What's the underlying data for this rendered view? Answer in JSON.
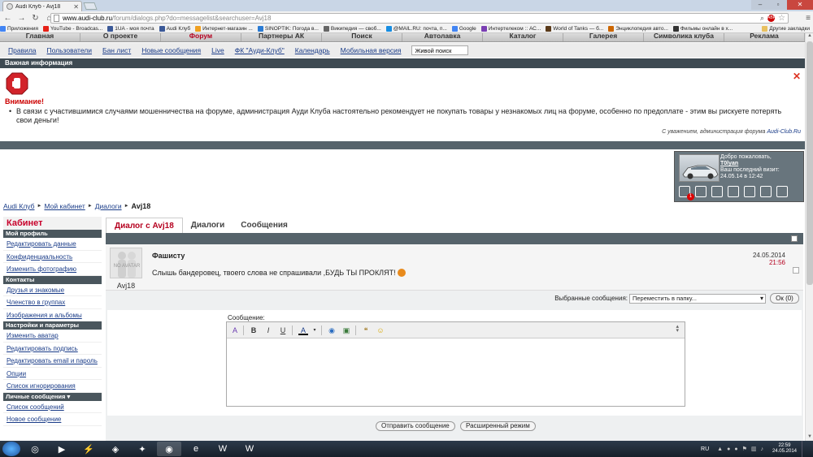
{
  "browser": {
    "tab_title": "Audi Клуб - Avj18",
    "url_host": "www.audi-club.ru",
    "url_path": "/forum/dialogs.php?do=messagelist&searchuser=Avj18",
    "bookmarks": [
      {
        "label": "Приложения",
        "icon": "apps-icon",
        "color": "#4285f4"
      },
      {
        "label": "YouTube - Broadcas...",
        "icon": "youtube-icon",
        "color": "#e62117"
      },
      {
        "label": "1UA - моя почта",
        "icon": "mail-icon",
        "color": "#3b5998"
      },
      {
        "label": "Audi Клуб",
        "icon": "audi-icon",
        "color": "#3b5998"
      },
      {
        "label": "Интернет-магазин ...",
        "icon": "shop-icon",
        "color": "#f0a020"
      },
      {
        "label": "SINOPTIK: Погода в...",
        "icon": "weather-icon",
        "color": "#2a7bd4"
      },
      {
        "label": "Википедия — своб...",
        "icon": "wiki-icon",
        "color": "#666666"
      },
      {
        "label": "@MAIL.RU: почта, п...",
        "icon": "mailru-icon",
        "color": "#168de2"
      },
      {
        "label": "Google",
        "icon": "google-icon",
        "color": "#4285f4"
      },
      {
        "label": "Интертелеком :: АС...",
        "icon": "intertelecom-icon",
        "color": "#7a3fb3"
      },
      {
        "label": "World of Tanks — б...",
        "icon": "wot-icon",
        "color": "#5a3a1a"
      },
      {
        "label": "Энциклопедия авто...",
        "icon": "encyclopedia-icon",
        "color": "#cc6600"
      },
      {
        "label": "Фильмы онлайн в х...",
        "icon": "film-icon",
        "color": "#333333"
      }
    ],
    "other_bookmarks": "Другие закладки"
  },
  "main_nav": [
    {
      "label": "Главная",
      "active": false
    },
    {
      "label": "О проекте",
      "active": false
    },
    {
      "label": "Форум",
      "active": true
    },
    {
      "label": "Партнеры АК",
      "active": false
    },
    {
      "label": "Поиск",
      "active": false
    },
    {
      "label": "Автолавка",
      "active": false
    },
    {
      "label": "Каталог",
      "active": false
    },
    {
      "label": "Галерея",
      "active": false
    },
    {
      "label": "Символика клуба",
      "active": false
    },
    {
      "label": "Реклама",
      "active": false
    }
  ],
  "sub_nav": [
    "Правила",
    "Пользователи",
    "Бан лист",
    "Новые сообщения",
    "Live",
    "ФК \"Ауди-Клуб\"",
    "Календарь",
    "Мобильная версия"
  ],
  "live_search_placeholder": "Живой поиск",
  "notice": {
    "bar_title": "Важная информация",
    "heading": "Внимание!",
    "body": "В связи с участившимися случаями мошенничества на форуме, администрация Ауди Клуба настоятельно рекомендует не покупать товары у незнакомых лиц на форуме, особенно по предоплате - этим вы рискуете потерять свои деньги!",
    "sign_prefix": "С уважением, администрация форума",
    "sign_link": "Audi-Club.Ru"
  },
  "welcome": {
    "greeting": "Добро пожаловать,",
    "username": "T0lyan",
    "last_visit_label": "Ваш последний визит:",
    "last_visit": "24.05.14 в 12:42",
    "notifications": "1"
  },
  "breadcrumb": {
    "items": [
      "Audi Клуб",
      "Мой кабинет",
      "Диалоги"
    ],
    "current": "Avj18"
  },
  "sidebar": {
    "title": "Кабинет",
    "sections": [
      {
        "header": "Мой профиль",
        "links": [
          "Редактировать данные",
          "Конфиденциальность",
          "Изменить фотографию"
        ]
      },
      {
        "header": "Контакты",
        "links": [
          "Друзья и знакомые",
          "Членство в группах",
          "Изображения и альбомы"
        ]
      },
      {
        "header": "Настройки и параметры",
        "links": [
          "Изменить аватар",
          "Редактировать подпись",
          "Редактировать email и пароль",
          "Опции",
          "Список игнорирования"
        ]
      },
      {
        "header": "Личные сообщения ▾",
        "links": [
          "Список сообщений",
          "Новое сообщение"
        ]
      }
    ]
  },
  "tabs": [
    {
      "label": "Диалог с Avj18",
      "active": true
    },
    {
      "label": "Диалоги",
      "active": false
    },
    {
      "label": "Сообщения",
      "active": false
    }
  ],
  "message": {
    "avatar_text": "NO AVATAR",
    "author": "Avj18",
    "recipient": "Фашисту",
    "text": "Слышь бандеровец, твоего слова не спрашивали ,БУДЬ ТЫ ПРОКЛЯТ!",
    "date": "24.05.2014",
    "time": "21:56"
  },
  "selected": {
    "label": "Выбранные сообщения:",
    "select_value": "Переместить в папку...",
    "ok_label": "Ок (0)"
  },
  "reply": {
    "label": "Сообщение:",
    "send_label": "Отправить сообщение",
    "advanced_label": "Расширенный режим"
  },
  "taskbar": {
    "lang": "RU",
    "time": "22:59",
    "date": "24.05.2014"
  }
}
